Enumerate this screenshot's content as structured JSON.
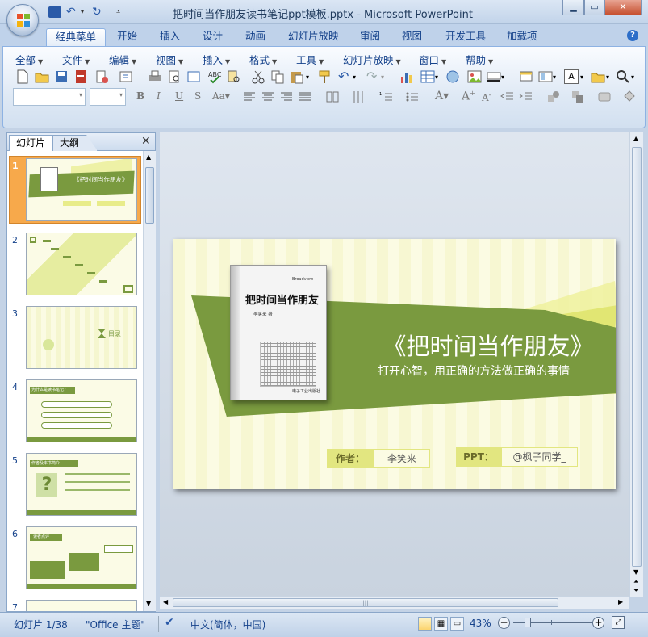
{
  "window": {
    "title": "把时间当作朋友读书笔记ppt模板.pptx - Microsoft PowerPoint"
  },
  "tabs": [
    "经典菜单",
    "开始",
    "插入",
    "设计",
    "动画",
    "幻灯片放映",
    "审阅",
    "视图",
    "开发工具",
    "加载项"
  ],
  "menus": [
    "全部",
    "文件",
    "编辑",
    "视图",
    "插入",
    "格式",
    "工具",
    "幻灯片放映",
    "窗口",
    "帮助"
  ],
  "pane": {
    "tab_slides": "幻灯片",
    "tab_outline": "大纲"
  },
  "thumbnails": [
    "1",
    "2",
    "3",
    "4",
    "5",
    "6",
    "7"
  ],
  "slide": {
    "book_title": "把时间当作朋友",
    "book_author": "李笑来 著",
    "book_badge": "Broadview",
    "book_pub": "电子工业出版社",
    "title": "《把时间当作朋友》",
    "subtitle": "打开心智，用正确的方法做正确的事情",
    "author_label": "作者：",
    "author_name": "李笑来",
    "ppt_label": "PPT：",
    "ppt_name": "@枫子同学_"
  },
  "thumb_text": {
    "t1_title": "《把时间当作朋友》",
    "t3_label": "目录",
    "t4_head": "为什么是读书笔记？",
    "t5_head": "作者及本书简介",
    "t6_head": "读者点评"
  },
  "status": {
    "slide": "幻灯片 1/38",
    "theme": "\"Office 主题\"",
    "lang": "中文(简体，中国)",
    "zoom": "43%"
  },
  "colors": {
    "green": "#7a9a3f",
    "yellow": "#e8ec8a",
    "paper": "#fbfbe3"
  }
}
